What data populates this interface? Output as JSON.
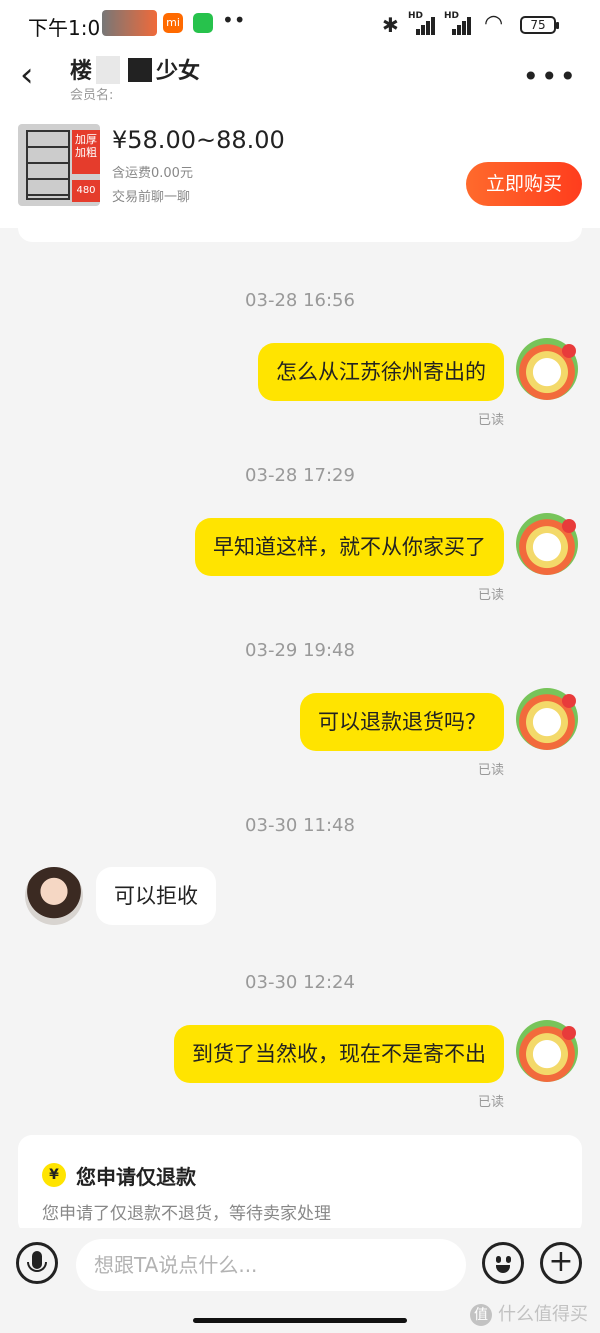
{
  "status_bar": {
    "time": "下午1:0",
    "mi_icon_label": "mi",
    "dots": "••",
    "network_1": "HD",
    "network_2": "HD",
    "battery": "75"
  },
  "header": {
    "shop_name": "楼",
    "shop_name_tail": "少女",
    "member_label": "会员名: ",
    "back_icon": "chevron-left",
    "more_icon": "more-horizontal"
  },
  "product": {
    "thumb_tag": "加厚加粗",
    "thumb_price": "480",
    "price": "¥58.00~88.00",
    "shipping": "含运费0.00元",
    "chat_note": "交易前聊一聊",
    "buy_label": "立即购买"
  },
  "messages": [
    {
      "time": "03-28 16:56",
      "side": "out",
      "text": "怎么从江苏徐州寄出的",
      "status": "已读"
    },
    {
      "time": "03-28 17:29",
      "side": "out",
      "text": "早知道这样，就不从你家买了",
      "status": "已读"
    },
    {
      "time": "03-29 19:48",
      "side": "out",
      "text": "可以退款退货吗？",
      "status": "已读"
    },
    {
      "time": "03-30 11:48",
      "side": "in",
      "text": "可以拒收"
    },
    {
      "time": "03-30 12:24",
      "side": "out",
      "text": "到货了当然收，现在不是寄不出",
      "status": "已读"
    }
  ],
  "refund_card": {
    "icon": "¥",
    "title": "您申请仅退款",
    "desc": "您申请了仅退款不退货，等待卖家处理"
  },
  "input_bar": {
    "placeholder": "想跟TA说点什么...",
    "add_label": "+"
  },
  "watermark": {
    "badge": "值",
    "text": "什么值得买"
  },
  "colors": {
    "bubble_out": "#ffe400",
    "bubble_in": "#ffffff",
    "buy_button": "#ff4a22",
    "background": "#f4f4f4"
  }
}
